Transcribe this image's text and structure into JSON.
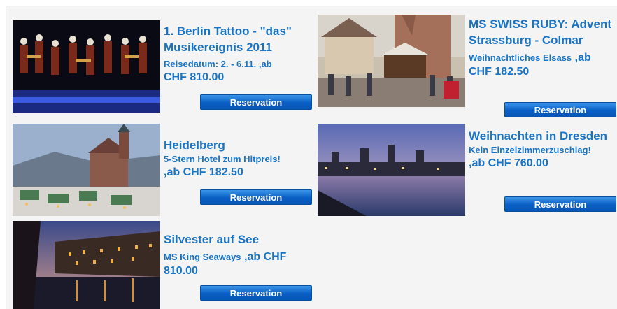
{
  "offers": [
    {
      "title": "1. Berlin Tattoo - \"das\" Musikereignis 2011",
      "subtitle": "Reisedatum: 2. - 6.11.",
      "price_prefix": " ,ab",
      "price": "CHF 810.00",
      "button": "Reservation"
    },
    {
      "title": "MS SWISS RUBY: Advent Strassburg - Colmar",
      "subtitle": "Weihnachtliches Elsass",
      "price_prefix": " ,ab",
      "price": "CHF 182.50",
      "button": "Reservation"
    },
    {
      "title": "Heidelberg",
      "subtitle": "5-Stern Hotel zum Hitpreis!",
      "price_prefix": ",ab",
      "price": "CHF 182.50",
      "button": "Reservation"
    },
    {
      "title": "Weihnachten in Dresden",
      "subtitle": "Kein Einzelzimmerzuschlag!",
      "price_prefix": ",ab",
      "price": "CHF 760.00",
      "button": "Reservation"
    },
    {
      "title": "Silvester auf See",
      "subtitle": "MS King Seaways",
      "price_prefix": " ,ab",
      "price": "CHF 810.00",
      "button": "Reservation"
    }
  ],
  "colors": {
    "text": "#1a74c4",
    "button": "#0a5fc4",
    "panel": "#f4f4f4"
  }
}
